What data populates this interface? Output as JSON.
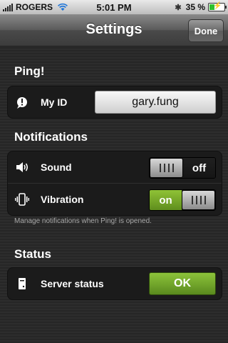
{
  "status_bar": {
    "carrier": "ROGERS",
    "time": "5:01 PM",
    "battery_percent": "35 %",
    "battery_level": 0.35
  },
  "nav": {
    "title": "Settings",
    "done_label": "Done"
  },
  "sections": {
    "ping": {
      "title": "Ping!",
      "my_id_label": "My ID",
      "my_id_value": "gary.fung"
    },
    "notifications": {
      "title": "Notifications",
      "sound_label": "Sound",
      "sound_state": "off",
      "vibration_label": "Vibration",
      "vibration_state": "on",
      "footnote": "Manage notifications when Ping! is opened."
    },
    "status": {
      "title": "Status",
      "server_label": "Server status",
      "server_value": "OK"
    }
  },
  "icons": {
    "ping": "ping-bubble-icon",
    "sound": "speaker-icon",
    "vibration": "vibration-icon",
    "server": "server-icon"
  },
  "colors": {
    "accent_green": "#7cb82f"
  }
}
